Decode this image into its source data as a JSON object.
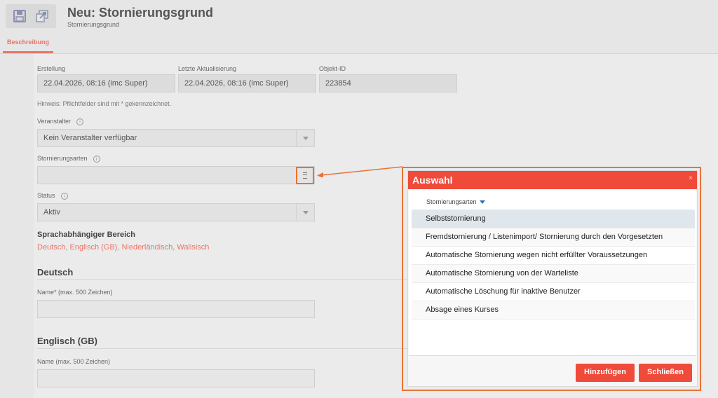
{
  "header": {
    "title": "Neu: Stornierungsgrund",
    "subtitle": "Stornierungsgrund"
  },
  "tabs": [
    {
      "label": "Beschreibung",
      "active": true
    }
  ],
  "icons": {
    "save": "save-icon",
    "open": "open-window-icon",
    "info": "info-icon",
    "picker": "list-picker-icon",
    "caret": "chevron-down-icon",
    "sort": "sort-down-icon",
    "close": "close-icon"
  },
  "colors": {
    "accent": "#e8756a",
    "dialog_header": "#f04a3a",
    "highlight": "#e8733a",
    "sort": "#2f6fb0"
  },
  "meta": {
    "created_label": "Erstellung",
    "created_value": "22.04.2026, 08:16 (imc Super)",
    "updated_label": "Letzte Aktualisierung",
    "updated_value": "22.04.2026, 08:16 (imc Super)",
    "id_label": "Objekt-ID",
    "id_value": "223854"
  },
  "hint": "Hinweis: Pflichtfelder sind mit * gekennzeichnet.",
  "fields": {
    "organizer_label": "Veranstalter",
    "organizer_value": "Kein Veranstalter verfügbar",
    "types_label": "Stornierungsarten",
    "types_value": "",
    "status_label": "Status",
    "status_value": "Aktiv"
  },
  "language_section": {
    "heading": "Sprachabhängiger Bereich",
    "languages": [
      "Deutsch",
      "Englisch (GB)",
      "Niederländisch",
      "Walisisch"
    ],
    "separator": ", "
  },
  "deutsch": {
    "heading": "Deutsch",
    "name_label": "Name* (max. 500 Zeichen)",
    "name_value": ""
  },
  "englisch": {
    "heading": "Englisch (GB)",
    "name_label": "Name (max. 500 Zeichen)",
    "name_value": ""
  },
  "dialog": {
    "title": "Auswahl",
    "close_glyph": "×",
    "column_header": "Stornierungsarten",
    "rows": [
      "Selbststornierung",
      "Fremdstornierung / Listenimport/ Stornierung durch den Vorgesetzten",
      "Automatische Stornierung wegen nicht erfüllter Voraussetzungen",
      "Automatische Stornierung von der Warteliste",
      "Automatische Löschung für inaktive Benutzer",
      "Absage eines Kurses"
    ],
    "selected_index": 0,
    "add_button": "Hinzufügen",
    "close_button": "Schließen"
  }
}
